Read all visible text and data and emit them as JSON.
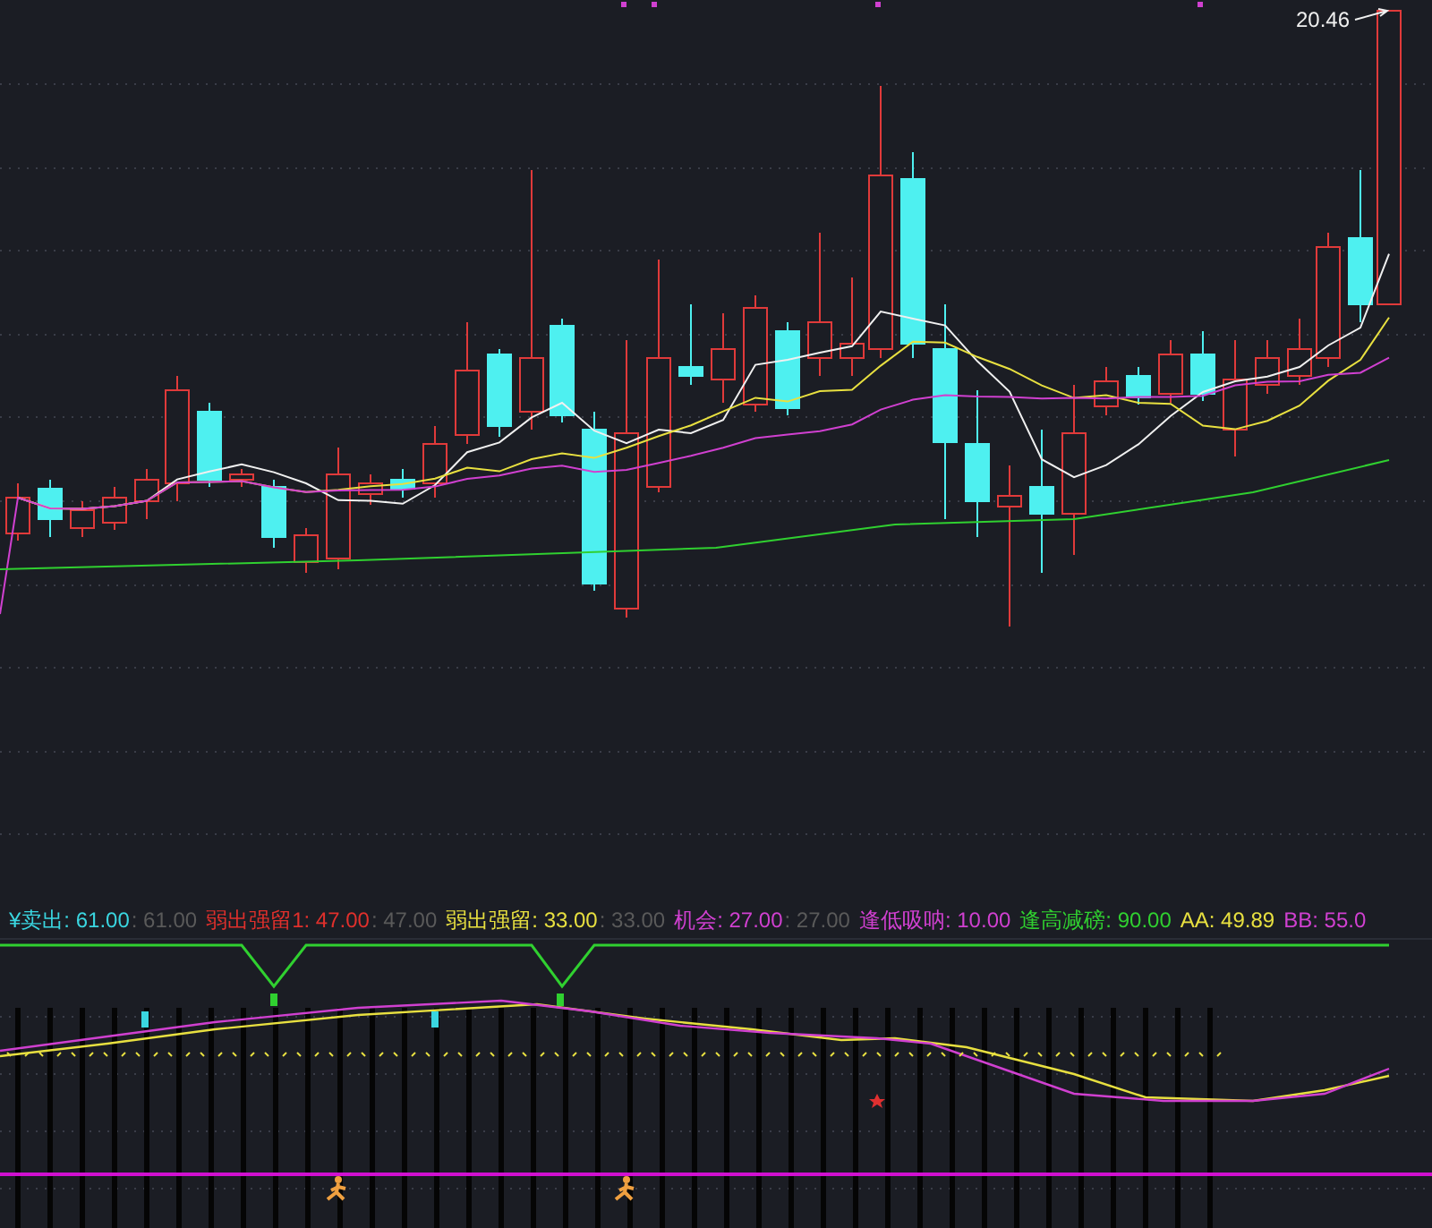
{
  "price_chart": {
    "high_label": "20.46"
  },
  "indicator_legend": [
    {
      "text": "¥卖出: 61.00",
      "echo": ": 61.00",
      "color": "#3ad6e0"
    },
    {
      "text": "弱出强留1: 47.00",
      "echo": ": 47.00",
      "color": "#e0302c"
    },
    {
      "text": "弱出强留: 33.00",
      "echo": ": 33.00",
      "color": "#e8e040"
    },
    {
      "text": "机会: 27.00",
      "echo": ": 27.00",
      "color": "#d040d0"
    },
    {
      "text": "逢低吸呐: 10.00",
      "color": "#d040d0"
    },
    {
      "text": "逢高减磅: 90.00",
      "color": "#30d030"
    },
    {
      "text": "AA: 49.89",
      "color": "#e8e040"
    },
    {
      "text": "BB: 55.0",
      "color": "#d040d0"
    }
  ]
}
